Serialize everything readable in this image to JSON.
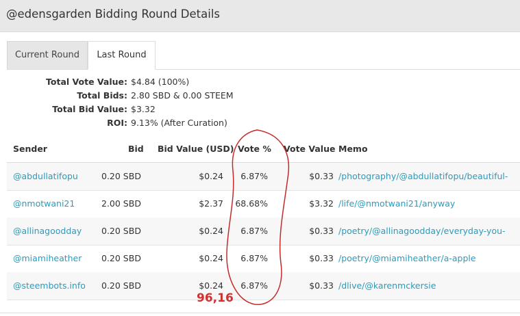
{
  "header": {
    "title": "@edensgarden Bidding Round Details"
  },
  "tabs": [
    {
      "label": "Current Round"
    },
    {
      "label": "Last Round"
    }
  ],
  "summary": [
    {
      "label": "Total Vote Value:",
      "value": "$4.84 (100%)"
    },
    {
      "label": "Total Bids:",
      "value": "2.80 SBD & 0.00 STEEM"
    },
    {
      "label": "Total Bid Value:",
      "value": "$3.32"
    },
    {
      "label": "ROI:",
      "value": "9.13% (After Curation)"
    }
  ],
  "table": {
    "headers": {
      "sender": "Sender",
      "bid": "Bid",
      "bid_value": "Bid Value (USD)",
      "vote_pct": "Vote %",
      "vote_value": "Vote Value",
      "memo": "Memo"
    },
    "rows": [
      {
        "sender": "@abdullatifopu",
        "bid": "0.20 SBD",
        "bid_value": "$0.24",
        "vote_pct": "6.87%",
        "vote_value": "$0.33",
        "memo": "/photography/@abdullatifopu/beautiful-"
      },
      {
        "sender": "@nmotwani21",
        "bid": "2.00 SBD",
        "bid_value": "$2.37",
        "vote_pct": "68.68%",
        "vote_value": "$3.32",
        "memo": "/life/@nmotwani21/anyway"
      },
      {
        "sender": "@allinagoodday",
        "bid": "0.20 SBD",
        "bid_value": "$0.24",
        "vote_pct": "6.87%",
        "vote_value": "$0.33",
        "memo": "/poetry/@allinagoodday/everyday-you-"
      },
      {
        "sender": "@miamiheather",
        "bid": "0.20 SBD",
        "bid_value": "$0.24",
        "vote_pct": "6.87%",
        "vote_value": "$0.33",
        "memo": "/poetry/@miamiheather/a-apple"
      },
      {
        "sender": "@steembots.info",
        "bid": "0.20 SBD",
        "bid_value": "$0.24",
        "vote_pct": "6.87%",
        "vote_value": "$0.33",
        "memo": "/dlive/@karenmckersie"
      }
    ]
  },
  "annotation": {
    "text": "96,16",
    "color": "#d43030"
  },
  "colors": {
    "link": "#2a9bbb",
    "header_bg": "#e8e8e8"
  }
}
